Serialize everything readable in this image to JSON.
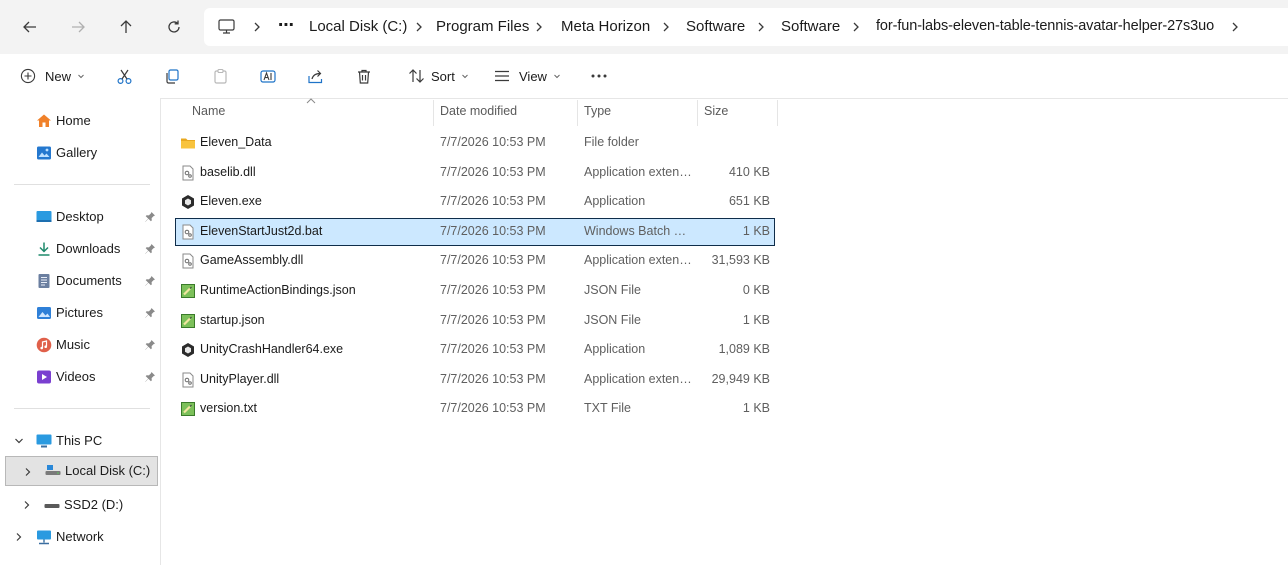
{
  "breadcrumb": {
    "more": "⋯",
    "items": [
      {
        "label": "Local Disk (C:)"
      },
      {
        "label": "Program Files"
      },
      {
        "label": "Meta Horizon"
      },
      {
        "label": "Software"
      },
      {
        "label": "Software"
      },
      {
        "label": "for-fun-labs-eleven-table-tennis-avatar-helper-27s3uo"
      }
    ]
  },
  "toolbar": {
    "new_label": "New",
    "sort_label": "Sort",
    "view_label": "View",
    "more_label": "···"
  },
  "sidebar": {
    "quick": [
      {
        "label": "Home"
      },
      {
        "label": "Gallery"
      }
    ],
    "pinned": [
      {
        "label": "Desktop"
      },
      {
        "label": "Downloads"
      },
      {
        "label": "Documents"
      },
      {
        "label": "Pictures"
      },
      {
        "label": "Music"
      },
      {
        "label": "Videos"
      }
    ],
    "this_pc": "This PC",
    "drives": [
      {
        "label": "Local Disk (C:)"
      },
      {
        "label": "SSD2 (D:)"
      }
    ],
    "network": "Network"
  },
  "columns": {
    "name": "Name",
    "date": "Date modified",
    "type": "Type",
    "size": "Size"
  },
  "files": [
    {
      "name": "Eleven_Data",
      "date": "7/7/2026 10:53 PM",
      "type": "File folder",
      "size": "",
      "icon": "folder-icon"
    },
    {
      "name": "baselib.dll",
      "date": "7/7/2026 10:53 PM",
      "type": "Application extens...",
      "size": "410 KB",
      "icon": "dll-file-icon"
    },
    {
      "name": "Eleven.exe",
      "date": "7/7/2026 10:53 PM",
      "type": "Application",
      "size": "651 KB",
      "icon": "unity-exe-icon"
    },
    {
      "name": "ElevenStartJust2d.bat",
      "date": "7/7/2026 10:53 PM",
      "type": "Windows Batch File",
      "size": "1 KB",
      "icon": "bat-file-icon"
    },
    {
      "name": "GameAssembly.dll",
      "date": "7/7/2026 10:53 PM",
      "type": "Application extens...",
      "size": "31,593 KB",
      "icon": "dll-file-icon"
    },
    {
      "name": "RuntimeActionBindings.json",
      "date": "7/7/2026 10:53 PM",
      "type": "JSON File",
      "size": "0 KB",
      "icon": "json-file-icon"
    },
    {
      "name": "startup.json",
      "date": "7/7/2026 10:53 PM",
      "type": "JSON File",
      "size": "1 KB",
      "icon": "json-file-icon"
    },
    {
      "name": "UnityCrashHandler64.exe",
      "date": "7/7/2026 10:53 PM",
      "type": "Application",
      "size": "1,089 KB",
      "icon": "unity-exe-icon"
    },
    {
      "name": "UnityPlayer.dll",
      "date": "7/7/2026 10:53 PM",
      "type": "Application extens...",
      "size": "29,949 KB",
      "icon": "dll-file-icon"
    },
    {
      "name": "version.txt",
      "date": "7/7/2026 10:53 PM",
      "type": "TXT File",
      "size": "1 KB",
      "icon": "txt-file-icon"
    }
  ],
  "selected_file": "ElevenStartJust2d.bat",
  "colors": {
    "selection_bg": "#cce8ff",
    "selection_border": "#0f2d4a",
    "folder": "#f8c33d",
    "accent": "#1e73c8"
  }
}
